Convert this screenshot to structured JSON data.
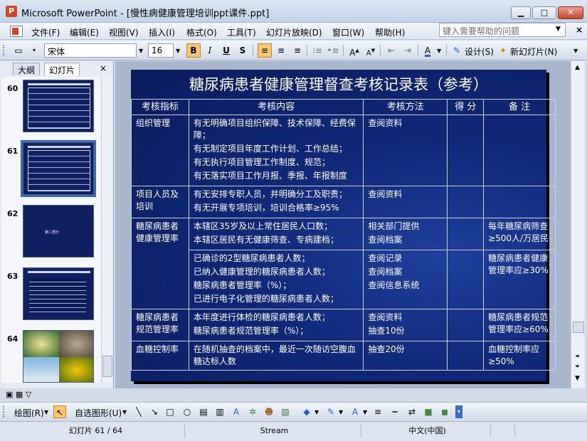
{
  "window": {
    "title": "Microsoft PowerPoint - [慢性病健康管理培训ppt课件.ppt]",
    "min_label": "▁",
    "max_label": "□",
    "close_label": "✕"
  },
  "menu": {
    "items": [
      "文件(F)",
      "编辑(E)",
      "视图(V)",
      "插入(I)",
      "格式(O)",
      "工具(T)",
      "幻灯片放映(D)",
      "窗口(W)",
      "帮助(H)"
    ],
    "help_placeholder": "键入需要帮助的问题"
  },
  "toolbar": {
    "font_name": "宋体",
    "font_size": "16",
    "bold": "B",
    "italic": "I",
    "underline": "U",
    "shadow": "S",
    "design_label": "设计(S)",
    "new_slide_label": "新幻灯片(N)"
  },
  "leftpane": {
    "tab_outline": "大纲",
    "tab_slides": "幻灯片",
    "close": "×",
    "slides": [
      {
        "num": "60",
        "kind": "table"
      },
      {
        "num": "61",
        "kind": "table",
        "selected": true
      },
      {
        "num": "62",
        "kind": "title",
        "mini_text": "第二部分"
      },
      {
        "num": "63",
        "kind": "list"
      },
      {
        "num": "64",
        "kind": "photos"
      }
    ]
  },
  "slide": {
    "title": "糖尿病患者健康管理督查考核记录表（参考）",
    "headers": [
      "考核指标",
      "考核内容",
      "考核方法",
      "得 分",
      "备 注"
    ],
    "rows": {
      "r1": {
        "indicator": "组织管理",
        "content": [
          "有无明确项目组织保障、技术保障、经费保障；",
          "有无制定项目年度工作计划、工作总结；",
          "有无执行项目管理工作制度、规范；",
          "有无落实项目工作月报、季报、年报制度"
        ],
        "method": "查阅资料",
        "note": ""
      },
      "r2": {
        "indicator": "项目人员及培训",
        "content": [
          "有无安排专职人员，并明确分工及职责；",
          "有无开展专项培训，培训合格率≥95%"
        ],
        "method": "查阅资料",
        "note": ""
      },
      "r3": {
        "indicator": "糖尿病患者健康管理率",
        "content": [
          "本辖区35岁及以上常住居民人口数；",
          "本辖区居民有无健康筛查、专病建档；"
        ],
        "method": [
          "相关部门提供",
          "查阅档案"
        ],
        "note": "每年糖尿病筛查≥500人/万居民"
      },
      "r4": {
        "content": [
          "已确诊的2型糖尿病患者人数；",
          "已纳入健康管理的糖尿病患者人数；",
          "糖尿病患者管理率（%）；",
          "已进行电子化管理的糖尿病患者人数；"
        ],
        "method": [
          "查阅记录",
          "查阅档案",
          "",
          "查阅信息系统"
        ],
        "note": "糖尿病患者健康管理率应≥30%"
      },
      "r5": {
        "indicator": "糖尿病患者规范管理率",
        "content": [
          "本年度进行体检的糖尿病患者人数；",
          "糖尿病患者规范管理率（%）；"
        ],
        "method": [
          "查阅资料",
          "抽查10份"
        ],
        "note": "糖尿病患者规范管理率应≥60%"
      },
      "r6": {
        "indicator": "血糖控制率",
        "content": [
          "在随机抽查的档案中，最近一次随访空腹血糖达标人数"
        ],
        "method": "抽查20份",
        "note": "血糖控制率应≥50%"
      }
    }
  },
  "drawbar": {
    "draw_label": "绘图(R)",
    "autoshape_label": "自选图形(U)"
  },
  "status": {
    "slide_info": "幻灯片 61 / 64",
    "design": "Stream",
    "language": "中文(中国)"
  }
}
